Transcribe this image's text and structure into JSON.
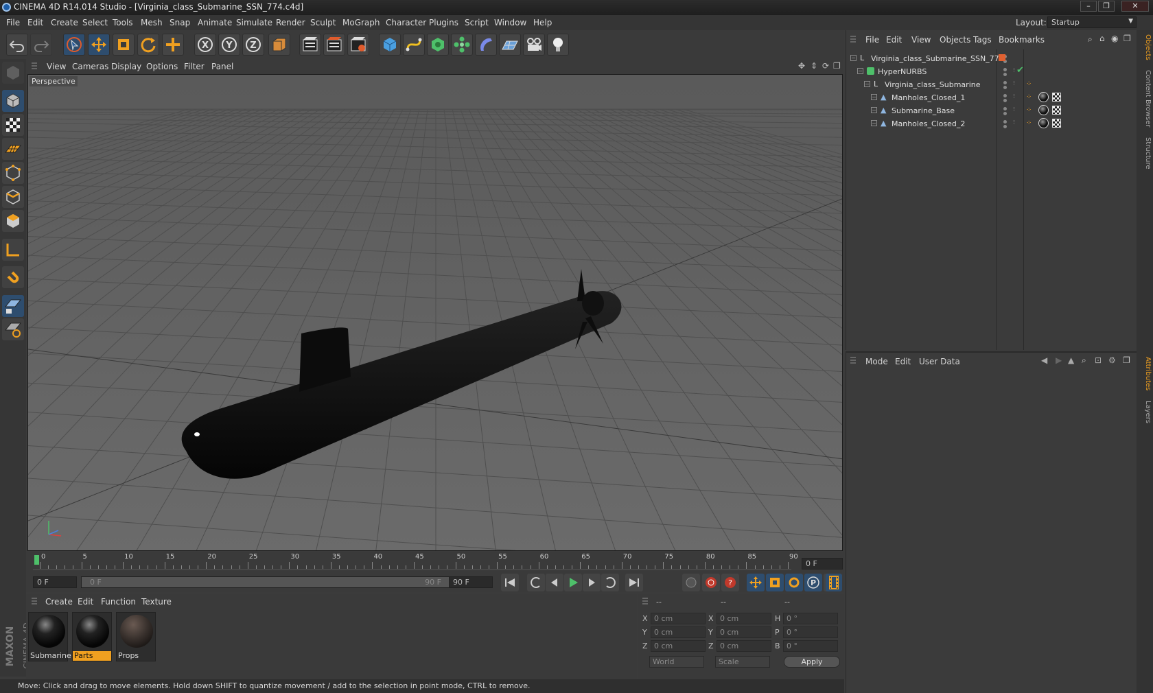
{
  "window": {
    "title": "CINEMA 4D R14.014 Studio - [Virginia_class_Submarine_SSN_774.c4d]",
    "layout_label": "Layout:",
    "layout_value": "Startup"
  },
  "menubar": [
    "File",
    "Edit",
    "Create",
    "Select",
    "Tools",
    "Mesh",
    "Snap",
    "Animate",
    "Simulate",
    "Render",
    "Sculpt",
    "MoGraph",
    "Character",
    "Plugins",
    "Script",
    "Window",
    "Help"
  ],
  "toolbar_icons": [
    "undo-icon",
    "redo-icon",
    "live-selection-icon",
    "move-icon",
    "scale-icon",
    "rotate-icon",
    "last-tool-icon",
    "x-axis-icon",
    "y-axis-icon",
    "z-axis-icon",
    "world-coordinates-icon",
    "render-view-icon",
    "render-picture-viewer-icon",
    "render-settings-icon",
    "cube-icon",
    "spline-icon",
    "nurbs-icon",
    "array-icon",
    "deformer-icon",
    "floor-icon",
    "camera-icon",
    "light-icon"
  ],
  "viewport": {
    "menu": [
      "View",
      "Cameras",
      "Display",
      "Options",
      "Filter",
      "Panel"
    ],
    "label": "Perspective"
  },
  "timeline": {
    "ticks": [
      "0",
      "5",
      "10",
      "15",
      "20",
      "25",
      "30",
      "35",
      "40",
      "45",
      "50",
      "55",
      "60",
      "65",
      "70",
      "75",
      "80",
      "85",
      "90"
    ],
    "current_frame": "0 F",
    "start_field": "0 F",
    "slider_start": "0 F",
    "slider_end": "90 F",
    "end_field": "90 F"
  },
  "materials": {
    "menu": [
      "Create",
      "Edit",
      "Function",
      "Texture"
    ],
    "items": [
      {
        "name": "Submarine",
        "selected": false
      },
      {
        "name": "Parts",
        "selected": true
      },
      {
        "name": "Props",
        "selected": false
      }
    ]
  },
  "coordinates": {
    "headers": [
      "--",
      "--",
      "--"
    ],
    "rows": [
      {
        "a": "X",
        "av": "0 cm",
        "b": "X",
        "bv": "0 cm",
        "c": "H",
        "cv": "0 °"
      },
      {
        "a": "Y",
        "av": "0 cm",
        "b": "Y",
        "bv": "0 cm",
        "c": "P",
        "cv": "0 °"
      },
      {
        "a": "Z",
        "av": "0 cm",
        "b": "Z",
        "bv": "0 cm",
        "c": "B",
        "cv": "0 °"
      }
    ],
    "mode": "World",
    "size_mode": "Scale",
    "apply": "Apply"
  },
  "status": "Move: Click and drag to move elements. Hold down SHIFT to quantize movement / add to the selection in point mode, CTRL to remove.",
  "object_manager": {
    "menu": [
      "File",
      "Edit",
      "View",
      "Objects",
      "Tags",
      "Bookmarks"
    ],
    "objects": [
      {
        "name": "Virginia_class_Submarine_SSN_774",
        "indent": 0
      },
      {
        "name": "HyperNURBS",
        "indent": 1
      },
      {
        "name": "Virginia_class_Submarine",
        "indent": 2
      },
      {
        "name": "Manholes_Closed_1",
        "indent": 3
      },
      {
        "name": "Submarine_Base",
        "indent": 3
      },
      {
        "name": "Manholes_Closed_2",
        "indent": 3
      }
    ]
  },
  "attributes": {
    "menu": [
      "Mode",
      "Edit",
      "User Data"
    ]
  },
  "side_tabs": [
    "Objects",
    "Content Browser",
    "Structure",
    "Attributes",
    "Layers"
  ],
  "branding": {
    "line1": "MAXON",
    "line2": "CINEMA 4D"
  }
}
